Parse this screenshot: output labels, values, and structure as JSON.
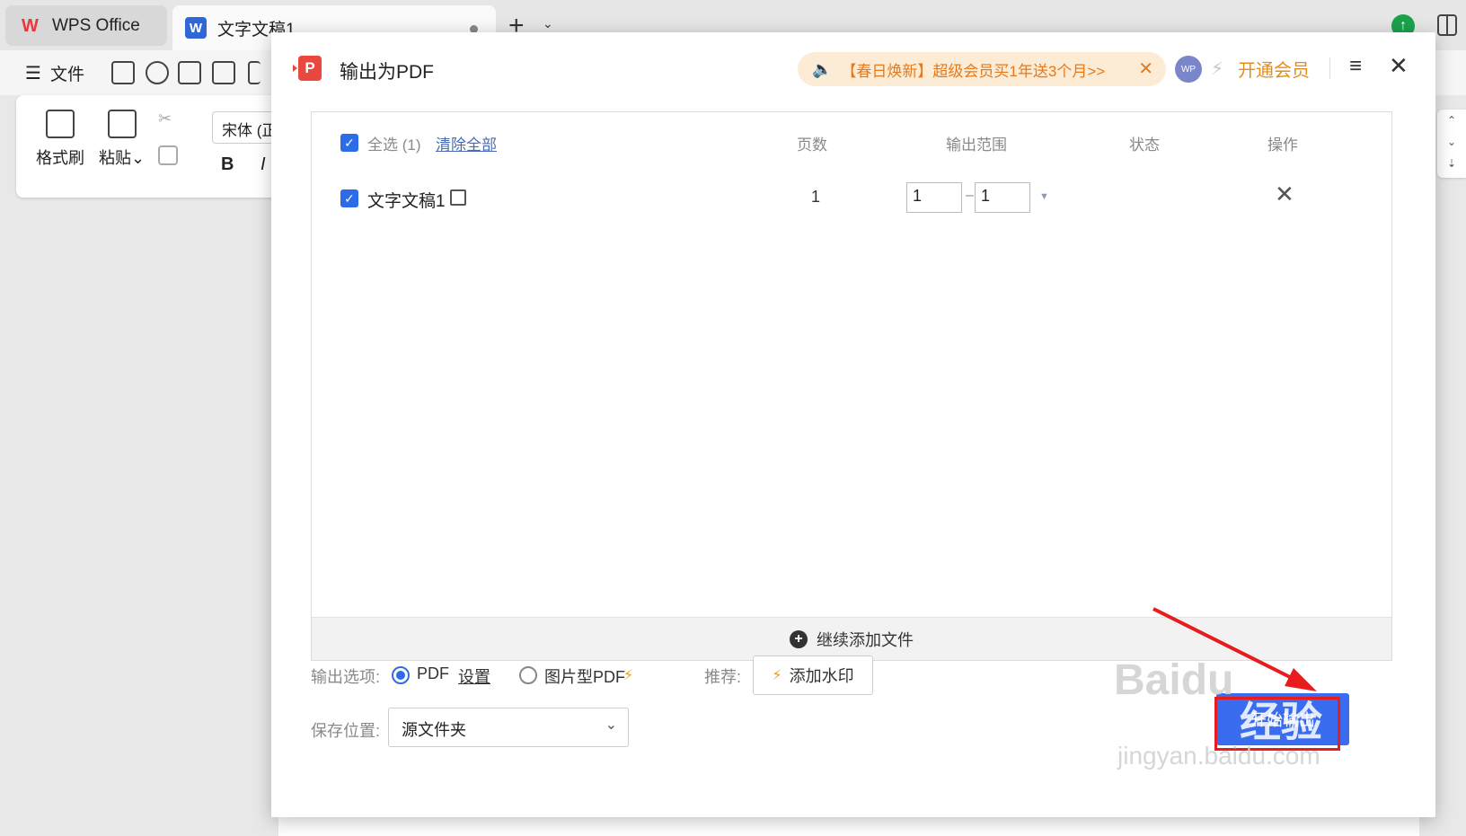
{
  "tabs": {
    "home_label": "WPS Office",
    "doc_label": "文字文稿1",
    "doc_icon_letter": "W",
    "add_symbol": "+",
    "more_symbol": "⌄"
  },
  "menubar": {
    "file_label": "文件",
    "hamburger": "☰"
  },
  "ribbon": {
    "format_brush": "格式刷",
    "paste": "粘贴",
    "paste_caret": "⌄",
    "font_name": "宋体 (正",
    "bold": "B",
    "italic": "I"
  },
  "right_strip": {
    "up": "⌃",
    "down": "⌄",
    "more": "⇣"
  },
  "dialog": {
    "logo_letter": "P",
    "title": "输出为PDF",
    "promo_text": "【春日焕新】超级会员买1年送3个月>>",
    "promo_close": "✕",
    "speaker": "🔈",
    "avatar_text": "WP",
    "vip_link": "开通会员",
    "menu_icon": "≡",
    "close_icon": "✕",
    "select_all": "全选 (1)",
    "clear_all": "清除全部",
    "col_pages": "页数",
    "col_range": "输出范围",
    "col_status": "状态",
    "col_action": "操作",
    "files": [
      {
        "name": "文字文稿1",
        "pages": "1",
        "range_from": "1",
        "range_to": "1",
        "status": ""
      }
    ],
    "range_dash": "–",
    "row_delete": "✕",
    "add_more": "继续添加文件",
    "output_options_label": "输出选项:",
    "option_pdf": "PDF",
    "option_settings": "设置",
    "option_image_pdf": "图片型PDF",
    "recommend_label": "推荐:",
    "add_watermark": "添加水印",
    "save_location_label": "保存位置:",
    "save_location_value": "源文件夹",
    "start_button": "开始输出"
  },
  "overlay": {
    "watermark_brand": "Baidu",
    "watermark_cn": "经验",
    "watermark_url": "jingyan.baidu.com"
  },
  "colors": {
    "accent_blue": "#2d6ce8",
    "highlight_red": "#e81c1c",
    "vip_orange": "#e58d18"
  }
}
